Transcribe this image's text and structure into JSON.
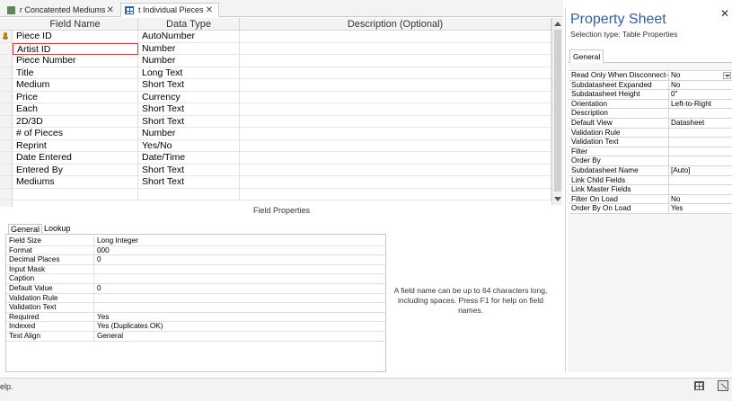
{
  "tabs": [
    {
      "label": "r Concatented Mediums",
      "icon": "query-icon"
    },
    {
      "label": "t Individual Pieces",
      "icon": "table-icon",
      "active": true
    }
  ],
  "grid": {
    "headers": [
      "Field Name",
      "Data Type",
      "Description (Optional)"
    ],
    "rows": [
      {
        "field": "Piece ID",
        "type": "AutoNumber",
        "description": ""
      },
      {
        "field": "Artist ID",
        "type": "Number",
        "description": ""
      },
      {
        "field": "Piece Number",
        "type": "Number",
        "description": ""
      },
      {
        "field": "Title",
        "type": "Long Text",
        "description": ""
      },
      {
        "field": "Medium",
        "type": "Short Text",
        "description": ""
      },
      {
        "field": "Price",
        "type": "Currency",
        "description": ""
      },
      {
        "field": "Each",
        "type": "Short Text",
        "description": ""
      },
      {
        "field": "2D/3D",
        "type": "Short Text",
        "description": ""
      },
      {
        "field": "# of Pieces",
        "type": "Number",
        "description": ""
      },
      {
        "field": "Reprint",
        "type": "Yes/No",
        "description": ""
      },
      {
        "field": "Date Entered",
        "type": "Date/Time",
        "description": ""
      },
      {
        "field": "Entered By",
        "type": "Short Text",
        "description": ""
      },
      {
        "field": "Mediums",
        "type": "Short Text",
        "description": ""
      },
      {
        "field": "",
        "type": "",
        "description": ""
      }
    ]
  },
  "field_properties": {
    "title": "Field Properties",
    "tabs": [
      "General",
      "Lookup"
    ],
    "rows": [
      {
        "label": "Field Size",
        "value": "Long Integer"
      },
      {
        "label": "Format",
        "value": "000"
      },
      {
        "label": "Decimal Places",
        "value": "0"
      },
      {
        "label": "Input Mask",
        "value": ""
      },
      {
        "label": "Caption",
        "value": ""
      },
      {
        "label": "Default Value",
        "value": "0"
      },
      {
        "label": "Validation Rule",
        "value": ""
      },
      {
        "label": "Validation Text",
        "value": ""
      },
      {
        "label": "Required",
        "value": "Yes"
      },
      {
        "label": "Indexed",
        "value": "Yes (Duplicates OK)"
      },
      {
        "label": "Text Align",
        "value": "General"
      }
    ],
    "hint": "A field name can be up to 64 characters long, including spaces. Press F1 for help on field names."
  },
  "property_sheet": {
    "title": "Property Sheet",
    "selection_type": "Selection type:  Table Properties",
    "tab": "General",
    "rows": [
      {
        "label": "Read Only When Disconnect-",
        "value": "No",
        "dropdown": true
      },
      {
        "label": "Subdatasheet Expanded",
        "value": "No"
      },
      {
        "label": "Subdatasheet Height",
        "value": "0\""
      },
      {
        "label": "Orientation",
        "value": "Left-to-Right"
      },
      {
        "label": "Description",
        "value": ""
      },
      {
        "label": "Default View",
        "value": "Datasheet"
      },
      {
        "label": "Validation Rule",
        "value": ""
      },
      {
        "label": "Validation Text",
        "value": ""
      },
      {
        "label": "Filter",
        "value": ""
      },
      {
        "label": "Order By",
        "value": ""
      },
      {
        "label": "Subdatasheet Name",
        "value": "[Auto]"
      },
      {
        "label": "Link Child Fields",
        "value": ""
      },
      {
        "label": "Link Master Fields",
        "value": ""
      },
      {
        "label": "Filter On Load",
        "value": "No"
      },
      {
        "label": "Order By On Load",
        "value": "Yes"
      }
    ]
  },
  "status": {
    "text": "elp.",
    "icons": [
      "datasheet-view-icon",
      "design-view-icon"
    ]
  }
}
